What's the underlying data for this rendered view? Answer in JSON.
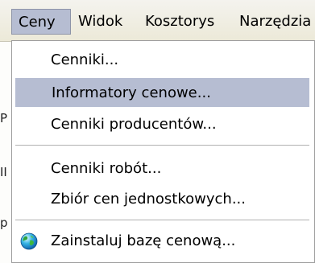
{
  "menubar": {
    "items": [
      {
        "label": "Ceny"
      },
      {
        "label": "Widok"
      },
      {
        "label": "Kosztorys"
      },
      {
        "label": "Narzędzia"
      }
    ]
  },
  "background": {
    "glyphs": [
      "P",
      "II",
      "p"
    ]
  },
  "dropdown": {
    "items": [
      {
        "label": "Cenniki..."
      },
      {
        "label": "Informatory cenowe..."
      },
      {
        "label": "Cenniki producentów..."
      },
      {
        "label": "Cenniki robót..."
      },
      {
        "label": "Zbiór cen jednostkowych..."
      },
      {
        "label": "Zainstaluj bazę cenową...",
        "icon": "globe-icon"
      }
    ]
  },
  "colors": {
    "highlight": "#b6bdd2",
    "menubar_bg": "#ece9d8",
    "menu_bg": "#ffffff"
  }
}
